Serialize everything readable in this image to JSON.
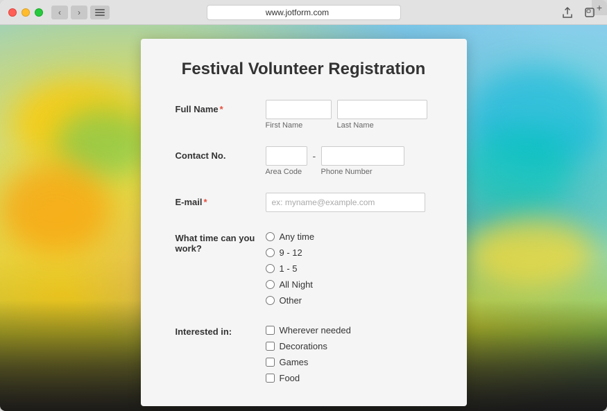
{
  "window": {
    "url": "www.jotform.com",
    "plus_label": "+"
  },
  "form": {
    "title": "Festival Volunteer Registration",
    "fields": {
      "full_name": {
        "label": "Full Name",
        "required": true,
        "first_name_placeholder": "",
        "last_name_placeholder": "",
        "first_name_sublabel": "First Name",
        "last_name_sublabel": "Last Name"
      },
      "contact": {
        "label": "Contact No.",
        "required": false,
        "area_code_placeholder": "",
        "phone_placeholder": "",
        "area_code_sublabel": "Area Code",
        "phone_sublabel": "Phone Number"
      },
      "email": {
        "label": "E-mail",
        "required": true,
        "placeholder": "ex: myname@example.com"
      },
      "work_time": {
        "label": "What time can you work?",
        "options": [
          {
            "value": "any_time",
            "label": "Any time"
          },
          {
            "value": "9_12",
            "label": "9 - 12"
          },
          {
            "value": "1_5",
            "label": "1 - 5"
          },
          {
            "value": "all_night",
            "label": "All Night"
          },
          {
            "value": "other",
            "label": "Other"
          }
        ]
      },
      "interested_in": {
        "label": "Interested in:",
        "options": [
          {
            "value": "wherever_needed",
            "label": "Wherever needed"
          },
          {
            "value": "decorations",
            "label": "Decorations"
          },
          {
            "value": "games",
            "label": "Games"
          },
          {
            "value": "food",
            "label": "Food"
          }
        ]
      }
    }
  }
}
